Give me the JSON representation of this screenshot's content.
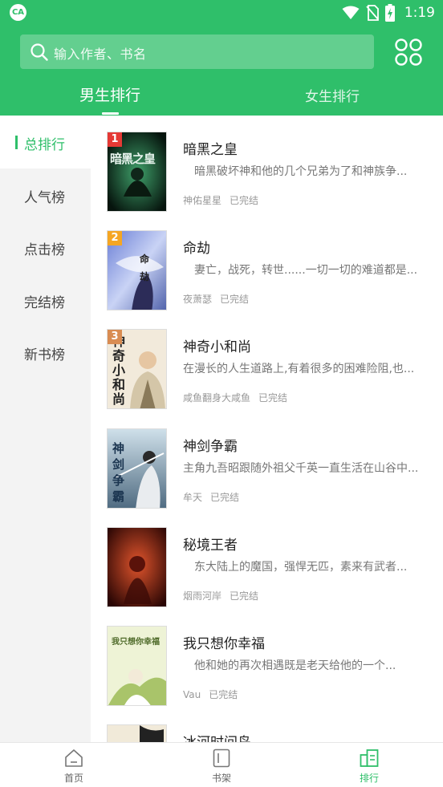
{
  "status": {
    "app_badge": "CA",
    "time": "1:19"
  },
  "search": {
    "placeholder": "输入作者、书名"
  },
  "tabs": [
    {
      "label": "男生排行"
    },
    {
      "label": "女生排行"
    }
  ],
  "sidebar": {
    "items": [
      {
        "label": "总排行"
      },
      {
        "label": "人气榜"
      },
      {
        "label": "点击榜"
      },
      {
        "label": "完结榜"
      },
      {
        "label": "新书榜"
      }
    ]
  },
  "books": [
    {
      "rank": "1",
      "title": "暗黑之皇",
      "desc": "暗黑破坏神和他的几个兄弟为了和神族争...",
      "author": "神佑星星",
      "status": "已完结",
      "cover_text": "暗黑之皇"
    },
    {
      "rank": "2",
      "title": "命劫",
      "desc": "妻亡，战死，转世......一切一切的难道都是...",
      "author": "夜萧瑟",
      "status": "已完结",
      "cover_text": "命劫"
    },
    {
      "rank": "3",
      "title": "神奇小和尚",
      "desc": "在漫长的人生道路上,有着很多的困难险阻,也...",
      "author": "咸鱼翻身大咸鱼",
      "status": "已完结",
      "cover_text": "神奇小和尚"
    },
    {
      "rank": "",
      "title": "神剑争霸",
      "desc": "主角九吾昭跟随外祖父千英一直生活在山谷中...",
      "author": "牟天",
      "status": "已完结",
      "cover_text": "神剑争霸"
    },
    {
      "rank": "",
      "title": "秘境王者",
      "desc": "东大陆上的魔国，强悍无匹，素来有武者...",
      "author": "烟雨河岸",
      "status": "已完结",
      "cover_text": ""
    },
    {
      "rank": "",
      "title": "我只想你幸福",
      "desc": "他和她的再次相遇既是老天给他的一个...",
      "author": "Vau",
      "status": "已完结",
      "cover_text": "我只想你幸福"
    },
    {
      "rank": "",
      "title": "冰河时间鸟",
      "desc": "",
      "author": "",
      "status": "",
      "cover_text": ""
    }
  ],
  "bottom_nav": [
    {
      "label": "首页"
    },
    {
      "label": "书架"
    },
    {
      "label": "排行"
    }
  ],
  "colors": {
    "accent": "#2fbf6a",
    "rank1": "#e53935",
    "rank2": "#f5a623",
    "rank3": "#d98c52"
  }
}
